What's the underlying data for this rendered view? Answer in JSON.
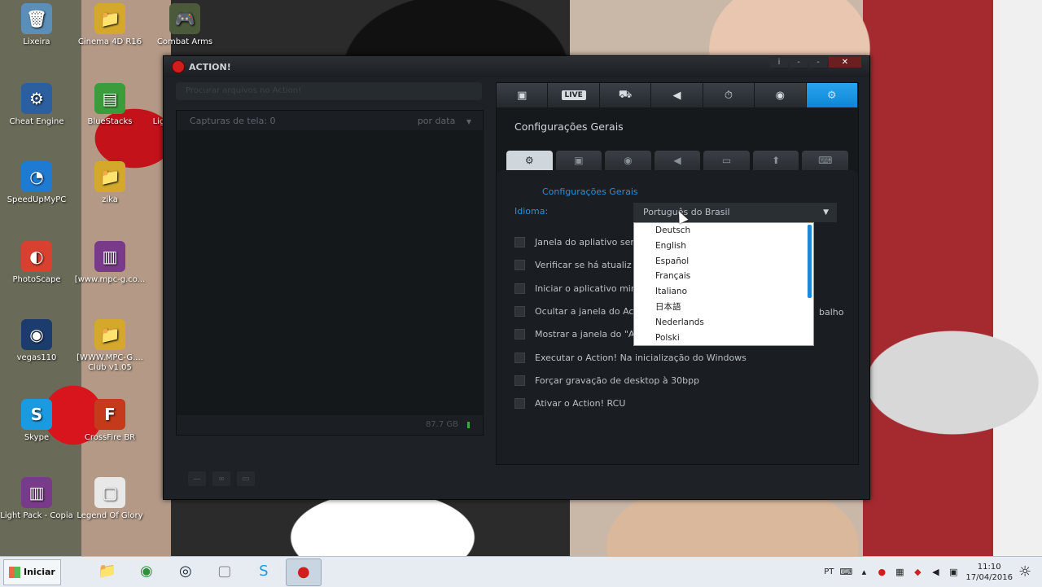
{
  "desktop": {
    "icons": [
      {
        "label": "Lixeira",
        "glyph": "🗑",
        "color": "#5b8fb8"
      },
      {
        "label": "Cinema 4D R16",
        "glyph": "📁",
        "color": "#d4a82a"
      },
      {
        "label": "Combat Arms",
        "glyph": "🎮",
        "color": "#4a5a3a"
      },
      {
        "label": "Cheat Engine",
        "glyph": "⚙",
        "color": "#2b5fa0"
      },
      {
        "label": "BlueStacks",
        "glyph": "▤",
        "color": "#3a9c3a"
      },
      {
        "label": "Lig",
        "glyph": "",
        "color": "transparent"
      },
      {
        "label": "SpeedUpMyPC",
        "glyph": "◔",
        "color": "#1f7bd1"
      },
      {
        "label": "zika",
        "glyph": "📁",
        "color": "#d4a82a"
      },
      {
        "label": "PhotoScape",
        "glyph": "◐",
        "color": "#d84030"
      },
      {
        "label": "[www.mpc-g.co...",
        "glyph": "▥",
        "color": "#7a3a8a"
      },
      {
        "label": "vegas110",
        "glyph": "◉",
        "color": "#1d3c6e"
      },
      {
        "label": "[WWW.MPC-G....",
        "label2": "Club v1.05",
        "glyph": "📁",
        "color": "#d4a82a"
      },
      {
        "label": "Skype",
        "glyph": "S",
        "color": "#1a9ae0"
      },
      {
        "label": "CrossFire BR",
        "glyph": "F",
        "color": "#c43a1a"
      },
      {
        "label": "Light Pack - Copia",
        "glyph": "▥",
        "color": "#7a3a8a"
      },
      {
        "label": "Legend Of Glory",
        "glyph": "▢",
        "color": "#e8e8e8"
      }
    ]
  },
  "window": {
    "title": "ACTION!",
    "info_icon": "i",
    "minimize": "-",
    "restore": "-",
    "close": "✕"
  },
  "left": {
    "search_placeholder": "Procurar arquivos no Action!",
    "list_header": "Capturas de tela: 0",
    "sort_label": "por data",
    "sort_arrow": "▼",
    "free_space": "87.7 GB"
  },
  "top_tabs": {
    "video": "▣",
    "live": "LIVE",
    "game": "⛟",
    "audio": "◀",
    "benchmark": "⏱",
    "screenshot": "◉",
    "settings": "⚙"
  },
  "settings": {
    "title": "Configurações Gerais",
    "sub_tabs": [
      "⚙",
      "▣",
      "◉",
      "◀",
      "▭",
      "⬆",
      "⌨"
    ],
    "group_label": "Configurações Gerais",
    "language_label": "Idioma:",
    "language_selected": "Português do Brasil",
    "dropdown_arrow": "▼",
    "language_options": [
      "Deutsch",
      "English",
      "Español",
      "Français",
      "Italiano",
      "日本語",
      "Nederlands",
      "Polski"
    ],
    "options": [
      "Janela do apliativo ser",
      "Verificar se há atualiz",
      "Iniciar o aplicativo min",
      "Ocultar a janela do Ac",
      "Mostrar a janela do \"A",
      "Executar o Action! Na inicialização do Windows",
      "Forçar gravação de desktop à 30bpp",
      "Ativar o Action! RCU"
    ],
    "option_overflow": "balho"
  },
  "taskbar": {
    "start_label": "Iniciar",
    "apps": [
      {
        "name": "explorer",
        "glyph": "📁",
        "color": "#d4a82a"
      },
      {
        "name": "chrome",
        "glyph": "◉",
        "color": "#2f8f3a"
      },
      {
        "name": "steam",
        "glyph": "◎",
        "color": "#1b2838"
      },
      {
        "name": "notepad",
        "glyph": "▢",
        "color": "#888"
      },
      {
        "name": "skype",
        "glyph": "S",
        "color": "#1a9ae0"
      },
      {
        "name": "action",
        "glyph": "●",
        "color": "#d21d1d"
      }
    ],
    "language": "PT",
    "time": "11:10",
    "date": "17/04/2016"
  }
}
